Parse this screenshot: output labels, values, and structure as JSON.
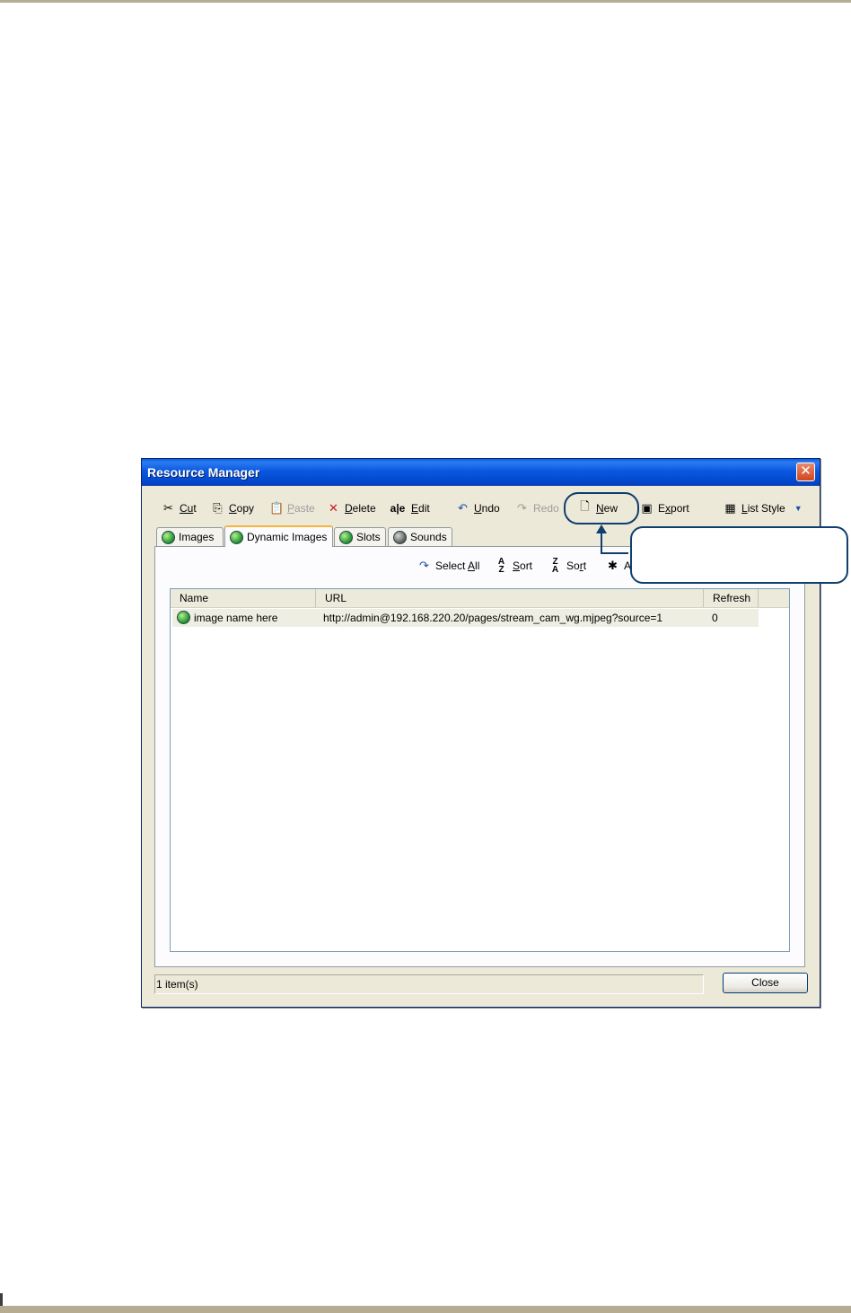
{
  "window": {
    "title": "Resource Manager",
    "close_glyph": "✕"
  },
  "toolbar": {
    "cut": {
      "icon": "scissors-icon",
      "label_u": "Cu",
      "label_rest": "t"
    },
    "copy": {
      "icon": "copy-icon",
      "label_u": "C",
      "label_rest": "opy"
    },
    "paste": {
      "icon": "paste-icon",
      "label_u": "P",
      "label_rest": "aste",
      "disabled": true
    },
    "delete": {
      "icon": "delete-x-icon",
      "label_u": "D",
      "label_rest": "elete"
    },
    "edit": {
      "icon": "edit-text-icon",
      "icon_glyph": "a|e",
      "label_u": "E",
      "label_rest": "dit"
    },
    "undo": {
      "icon": "undo-icon",
      "label_u": "U",
      "label_rest": "ndo"
    },
    "redo": {
      "icon": "redo-icon",
      "label": "Redo",
      "disabled": true
    },
    "new": {
      "icon": "new-document-icon",
      "label_u": "N",
      "label_rest": "ew"
    },
    "export": {
      "icon": "export-icon",
      "label_pre": "E",
      "label_u": "x",
      "label_rest": "port"
    },
    "list_style": {
      "icon": "list-style-icon",
      "label_u": "L",
      "label_rest": "ist Style",
      "arrow": "▼"
    }
  },
  "tabs": [
    {
      "label": "Images",
      "icon": "image-resource-icon",
      "active": false
    },
    {
      "label": "Dynamic Images",
      "icon": "dynamic-image-icon",
      "active": true
    },
    {
      "label": "Slots",
      "icon": "slots-icon",
      "active": false
    },
    {
      "label": "Sounds",
      "icon": "sounds-icon",
      "active": false
    }
  ],
  "panel_toolbar": {
    "select_all": {
      "icon": "select-all-icon",
      "label_pre": "Select ",
      "label_u": "A",
      "label_rest": "ll"
    },
    "sort_asc": {
      "icon": "sort-az-icon",
      "label_u": "S",
      "label_rest": "ort"
    },
    "sort_desc": {
      "icon": "sort-za-icon",
      "label_pre": "So",
      "label_u": "r",
      "label_rest": "t"
    },
    "add_partial": {
      "icon": "add-icon",
      "label": "A"
    }
  },
  "list": {
    "columns": [
      "Name",
      "URL",
      "Refresh"
    ],
    "rows": [
      {
        "name": "image name here",
        "url": "http://admin@192.168.220.20/pages/stream_cam_wg.mjpeg?source=1",
        "refresh": "0"
      }
    ]
  },
  "status": {
    "text": "1 item(s)"
  },
  "close_button": {
    "label": "Close"
  }
}
